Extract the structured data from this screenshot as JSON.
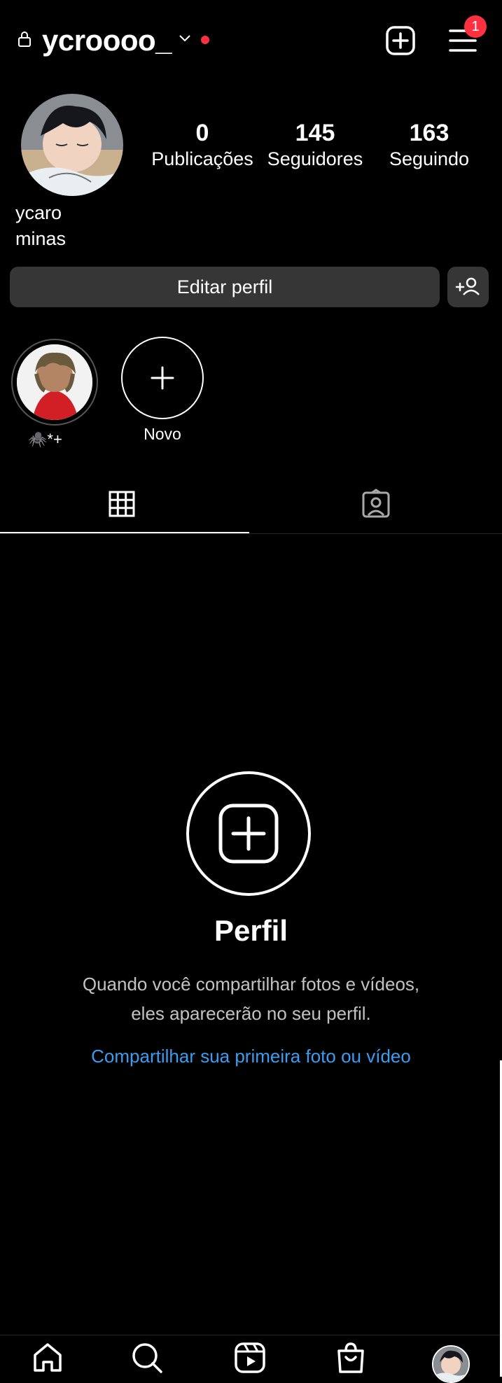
{
  "header": {
    "username": "ycroooo_",
    "notification_count": "1"
  },
  "profile": {
    "name_line1": "ycaro",
    "name_line2": "minas",
    "stats": [
      {
        "number": "0",
        "label": "Publicações"
      },
      {
        "number": "145",
        "label": "Seguidores"
      },
      {
        "number": "163",
        "label": "Seguindo"
      }
    ]
  },
  "actions": {
    "edit_profile": "Editar perfil"
  },
  "highlights": [
    {
      "label": "🕷️*+"
    },
    {
      "label": "Novo"
    }
  ],
  "tabs": [
    {
      "icon": "grid-icon",
      "active": true
    },
    {
      "icon": "tagged-icon",
      "active": false
    }
  ],
  "empty_state": {
    "title": "Perfil",
    "description": "Quando você compartilhar fotos e vídeos, eles aparecerão no seu perfil.",
    "link": "Compartilhar sua primeira foto ou vídeo"
  },
  "bottom_nav": [
    "home-icon",
    "search-icon",
    "reels-icon",
    "shop-icon",
    "profile-avatar"
  ],
  "colors": {
    "background": "#000000",
    "button": "#363636",
    "accent_link": "#3b9cf0",
    "badge": "#ff3040"
  }
}
